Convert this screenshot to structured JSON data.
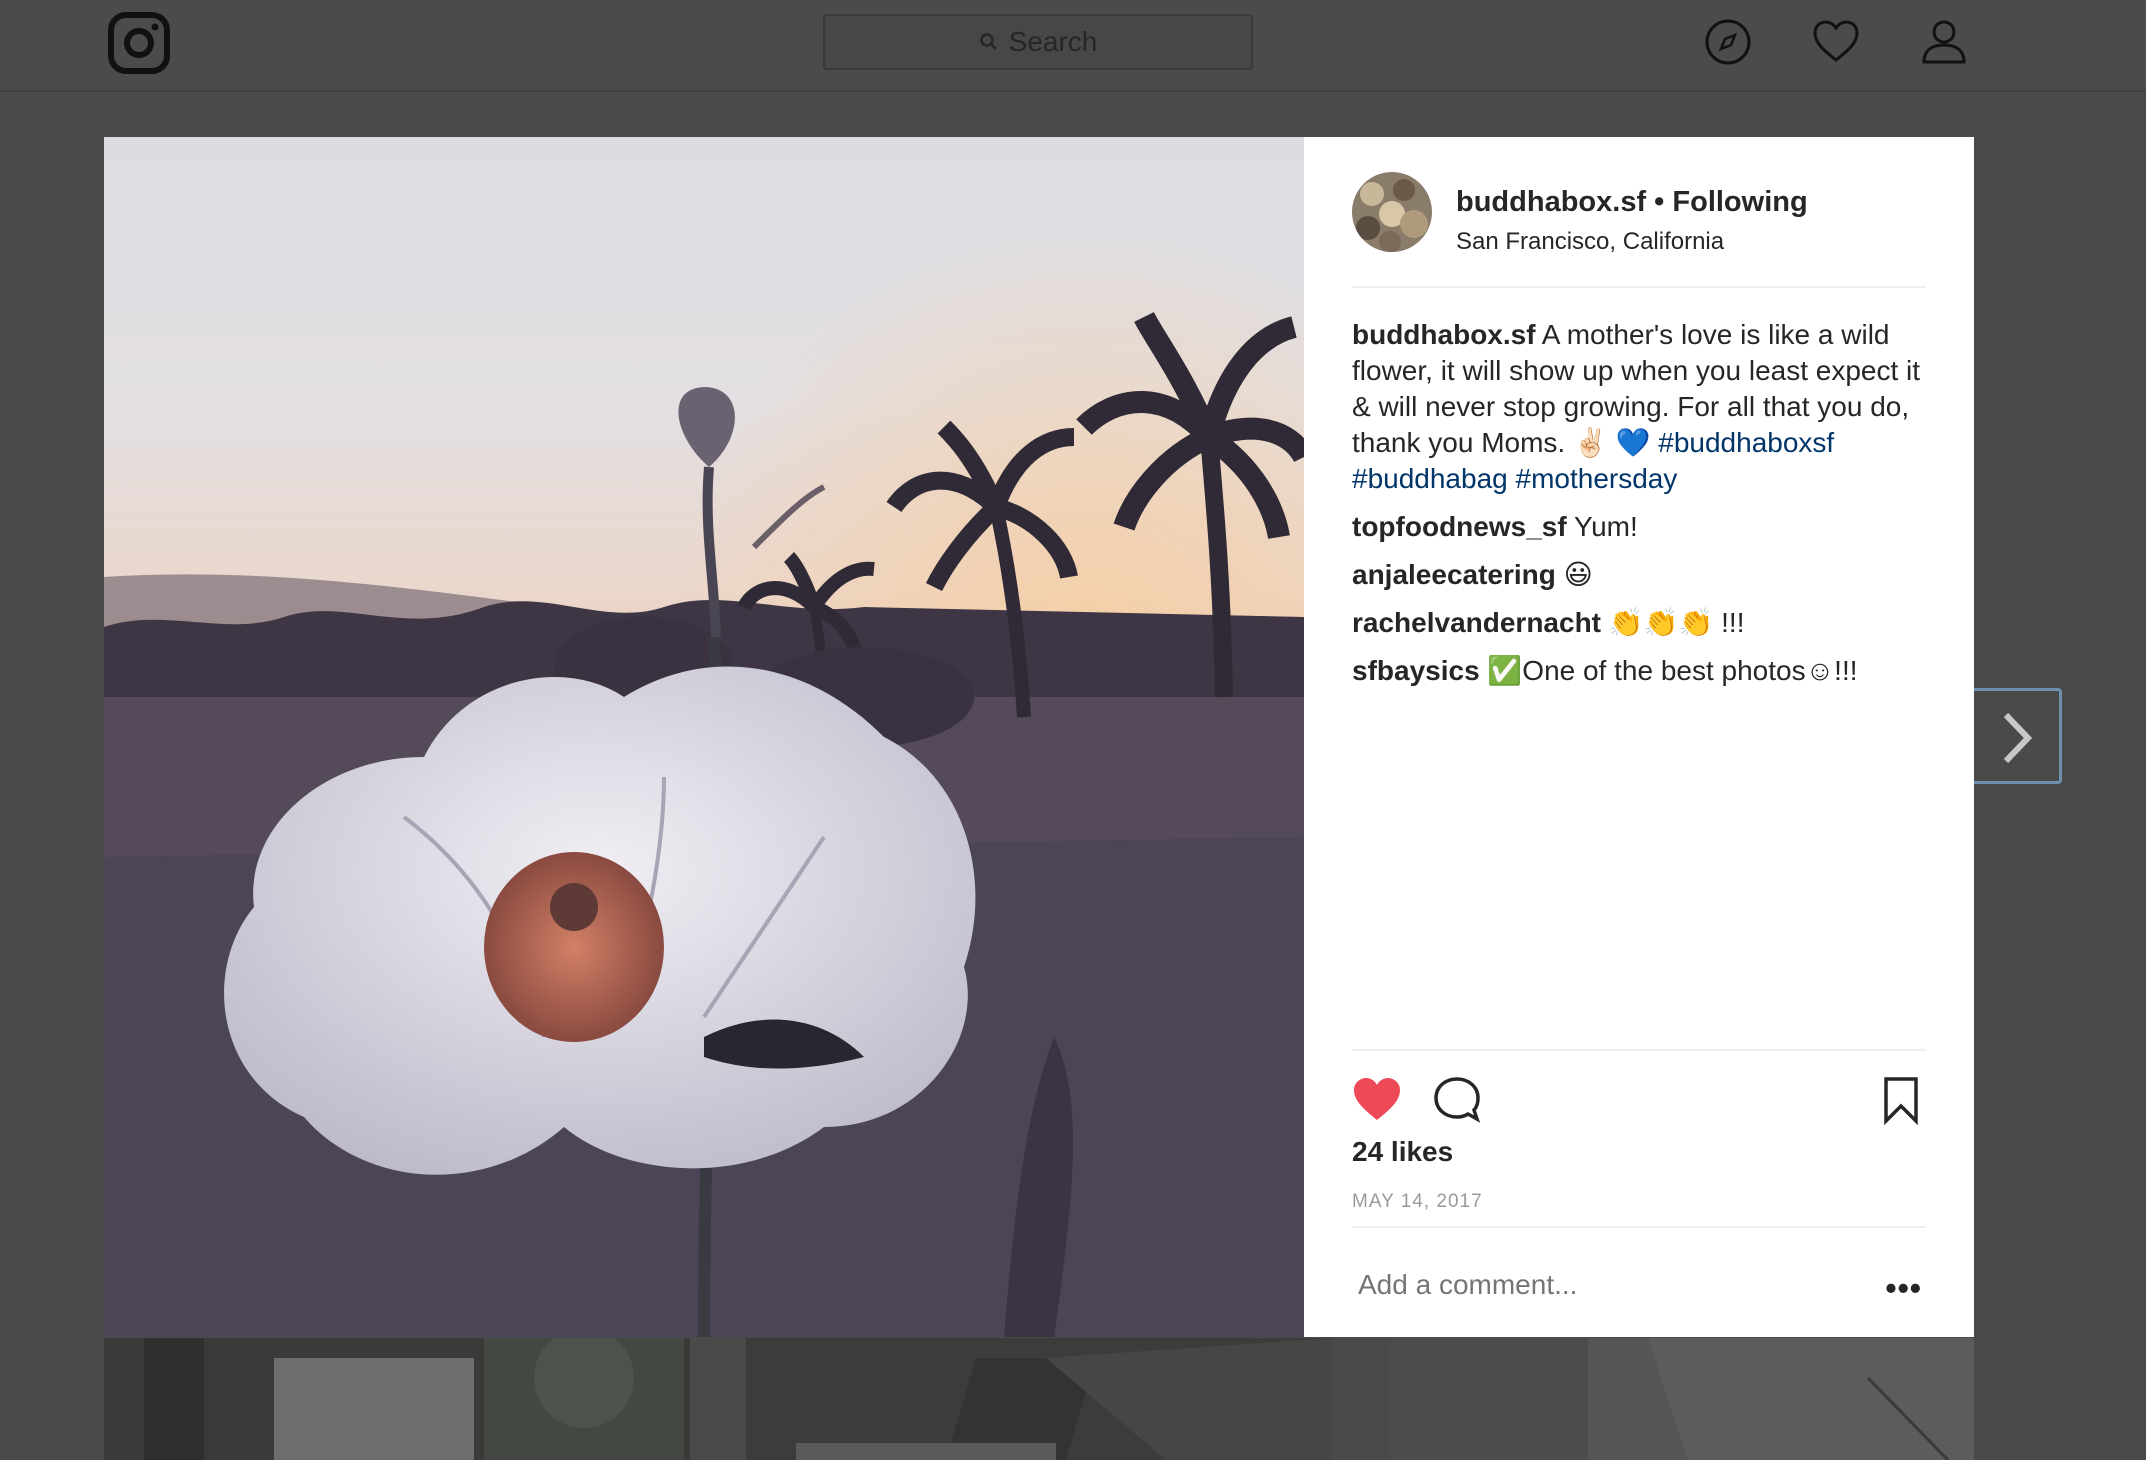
{
  "nav": {
    "search_placeholder": "Search",
    "icons": [
      "instagram-logo-icon",
      "compass-icon",
      "heart-icon",
      "profile-icon"
    ]
  },
  "post": {
    "username": "buddhabox.sf",
    "follow_status": "Following",
    "separator": "•",
    "location": "San Francisco, California",
    "caption": {
      "author": "buddhabox.sf",
      "text": "A mother's love is like a wild flower, it will show up when you least expect it & will never stop growing. For all that you do, thank you Moms. ✌🏻 💙 ",
      "hashtags": [
        "#buddhaboxsf",
        "#buddhabag",
        "#mothersday"
      ]
    },
    "comments": [
      {
        "user": "topfoodnews_sf",
        "text": "Yum!"
      },
      {
        "user": "anjaleecatering",
        "text": "😃"
      },
      {
        "user": "rachelvandernacht",
        "text": "👏👏👏 !!!"
      },
      {
        "user": "sfbaysics",
        "text": "✅One of the best photos☺!!!"
      }
    ],
    "likes": "24 likes",
    "date": "MAY 14, 2017",
    "liked": true,
    "add_comment_placeholder": "Add a comment...",
    "more_label": "•••"
  },
  "colors": {
    "like_red": "#ed4956",
    "hashtag_blue": "#003569",
    "overlay_bg": "#4a4a4a",
    "next_button_border": "#6f8fae"
  }
}
